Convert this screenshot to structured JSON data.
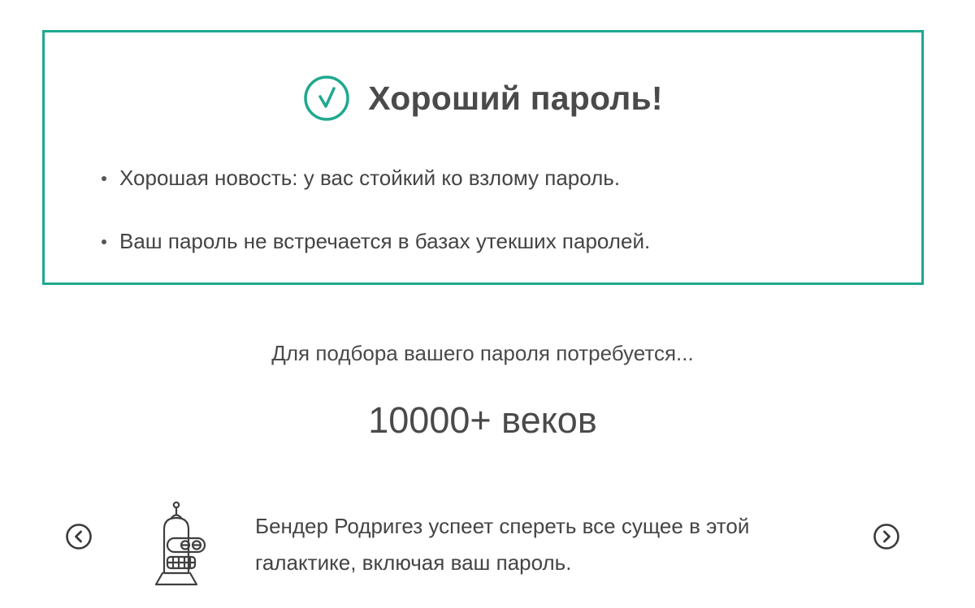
{
  "result": {
    "title": "Хороший пароль!",
    "icon": "check-circle-icon",
    "accent_color": "#1fa88e",
    "items": [
      "Хорошая новость: у вас стойкий ко взлому пароль.",
      "Ваш пароль не встречается в базах утекших паролей."
    ]
  },
  "crack": {
    "label": "Для подбора вашего пароля потребуется...",
    "time": "10000+ веков"
  },
  "carousel": {
    "prev_icon": "chevron-left-circle-icon",
    "next_icon": "chevron-right-circle-icon",
    "character_icon": "bender-robot-icon",
    "text": "Бендер Родригез успеет спереть все сущее в этой галактике, включая ваш пароль."
  }
}
